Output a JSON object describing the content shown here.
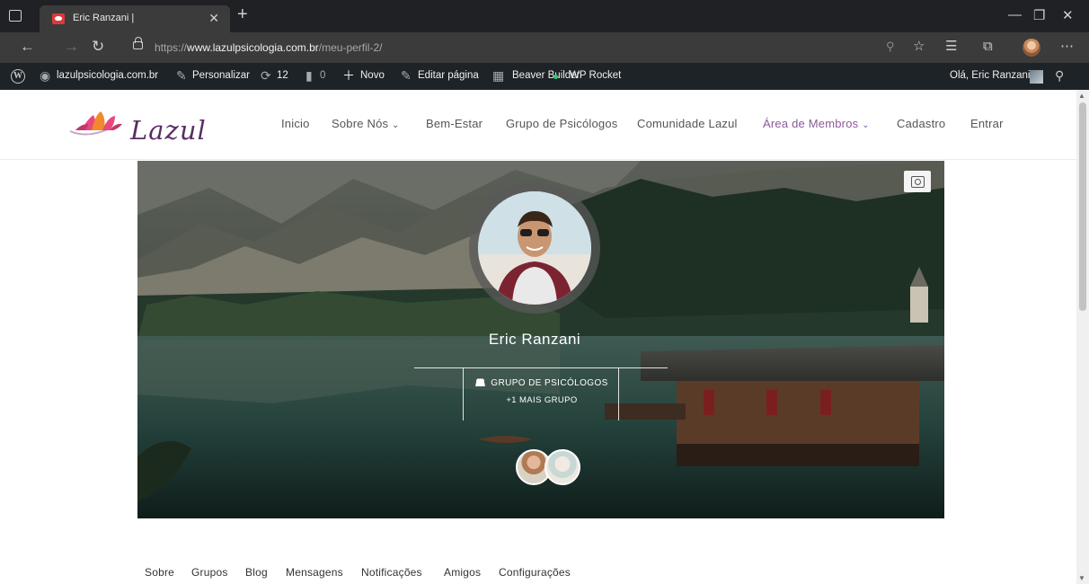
{
  "browser": {
    "tab_title": "Eric Ranzani |",
    "url_prefix": "https://",
    "url_domain": "www.lazulpsicologia.com.br",
    "url_path": "/meu-perfil-2/"
  },
  "admin_bar": {
    "site": "lazulpsicologia.com.br",
    "customize": "Personalizar",
    "updates": "12",
    "comments": "0",
    "new": "Novo",
    "edit_page": "Editar página",
    "beaver": "Beaver Builder",
    "wp_rocket": "WP Rocket",
    "greeting": "Olá, Eric Ranzani"
  },
  "site": {
    "logo": "Lazul",
    "menu": [
      {
        "label": "Inicio"
      },
      {
        "label": "Sobre Nós"
      },
      {
        "label": "Bem-Estar"
      },
      {
        "label": "Grupo de Psicólogos"
      },
      {
        "label": "Comunidade Lazul"
      },
      {
        "label": "Área de Membros"
      },
      {
        "label": "Cadastro"
      },
      {
        "label": "Entrar"
      }
    ],
    "accent_color": "#8a5a9a"
  },
  "profile": {
    "name": "Eric Ranzani",
    "group": "GRUPO DE PSICÓLOGOS",
    "more_groups": "+1 MAIS GRUPO",
    "tabs": [
      {
        "label": "Sobre"
      },
      {
        "label": "Grupos"
      },
      {
        "label": "Blog"
      },
      {
        "label": "Mensagens"
      },
      {
        "label": "Notificações"
      },
      {
        "label": "Amigos"
      },
      {
        "label": "Configurações"
      }
    ]
  },
  "colors": {
    "admin_bar_bg": "#1d2327",
    "browser_bg": "#202124"
  }
}
